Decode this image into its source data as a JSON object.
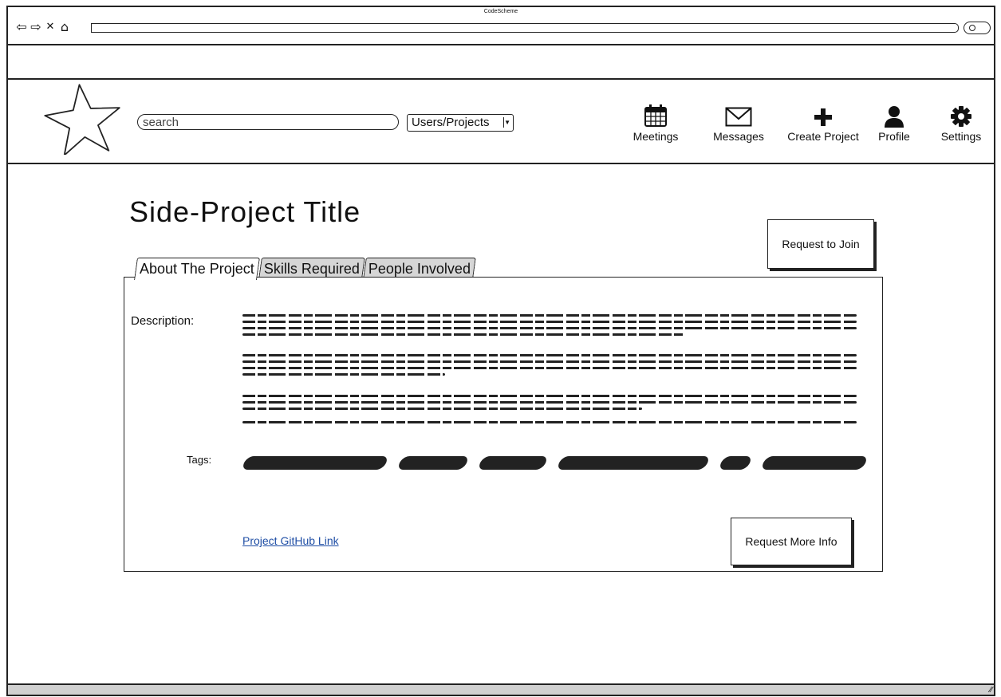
{
  "window": {
    "title": "CodeScheme"
  },
  "header": {
    "search_placeholder": "search",
    "search_type": "Users/Projects",
    "nav": [
      {
        "label": "Meetings",
        "icon": "calendar-icon"
      },
      {
        "label": "Messages",
        "icon": "envelope-icon"
      },
      {
        "label": "Create Project",
        "icon": "plus-icon"
      },
      {
        "label": "Profile",
        "icon": "user-icon"
      },
      {
        "label": "Settings",
        "icon": "gear-icon"
      }
    ]
  },
  "main": {
    "title": "Side-Project Title",
    "request_join_label": "Request to Join",
    "tabs": [
      "About The Project",
      "Skills Required",
      "People Involved"
    ],
    "description_label": "Description:",
    "tags_label": "Tags:",
    "github_link": "Project GitHub Link",
    "request_info_label": "Request More Info"
  }
}
